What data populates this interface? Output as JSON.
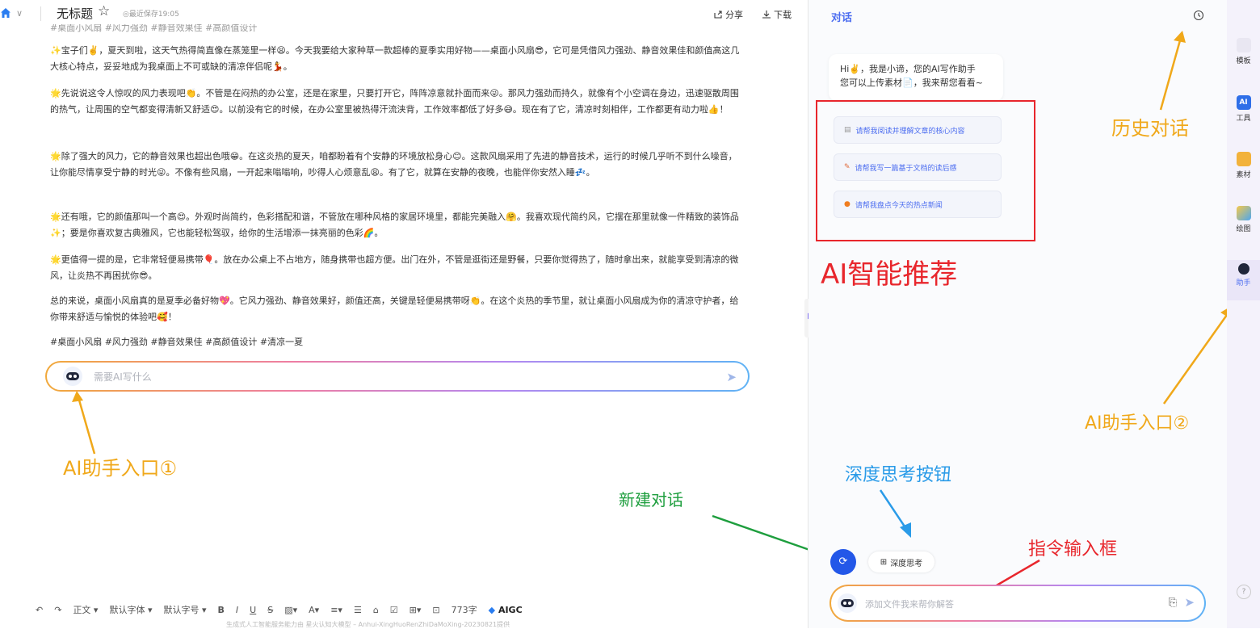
{
  "header": {
    "title": "无标题",
    "saved": "◎最近保存19:05",
    "share": "分享",
    "download": "下载"
  },
  "editor": {
    "clipped_line": "#桌面小风扇 #风力强劲 #静音效果佳 #高颜值设计",
    "paragraphs": [
      "✨宝子们✌️，夏天到啦，这天气热得简直像在蒸笼里一样😫。今天我要给大家种草一款超棒的夏季实用好物——桌面小风扇😎，它可是凭借风力强劲、静音效果佳和颜值高这几大核心特点，妥妥地成为我桌面上不可或缺的清凉伴侣呢💃。",
      "🌟先说说这令人惊叹的风力表现吧👏。不管是在闷热的办公室，还是在家里，只要打开它，阵阵凉意就扑面而来😜。那风力强劲而持久，就像有个小空调在身边，迅速驱散周围的热气，让周围的空气都变得清新又舒适😍。以前没有它的时候，在办公室里被热得汗流浃背，工作效率都低了好多😅。现在有了它，清凉时刻相伴，工作都更有动力啦👍！",
      "🌟除了强大的风力，它的静音效果也超出色哦😁。在这炎热的夏天，咱都盼着有个安静的环境放松身心😊。这款风扇采用了先进的静音技术，运行的时候几乎听不到什么噪音，让你能尽情享受宁静的时光😜。不像有些风扇，一开起来嗡嗡响，吵得人心烦意乱😩。有了它，就算在安静的夜晚，也能伴你安然入睡💤。",
      "🌟还有哦，它的颜值那叫一个高😍。外观时尚简约，色彩搭配和谐，不管放在哪种风格的家居环境里，都能完美融入🤗。我喜欢现代简约风，它摆在那里就像一件精致的装饰品✨；要是你喜欢复古典雅风，它也能轻松驾驭，给你的生活增添一抹亮丽的色彩🌈。",
      "🌟更值得一提的是，它非常轻便易携带🎈。放在办公桌上不占地方，随身携带也超方便。出门在外，不管是逛街还是野餐，只要你觉得热了，随时拿出来，就能享受到清凉的微风，让炎热不再困扰你😎。",
      "总的来说，桌面小风扇真的是夏季必备好物💖。它风力强劲、静音效果好，颜值还高，关键是轻便易携带呀👏。在这个炎热的季节里，就让桌面小风扇成为你的清凉守护者，给你带来舒适与愉悦的体验吧🥰！",
      "#桌面小风扇 #风力强劲 #静音效果佳 #高颜值设计 #清凉一夏"
    ],
    "ai_placeholder": "需要AI写什么",
    "toolbar": {
      "body_style": "正文 ▾",
      "font": "默认字体 ▾",
      "font_size": "默认字号 ▾",
      "bold": "B",
      "italic": "I",
      "underline": "U",
      "strike": "S",
      "word_count": "773字",
      "aigc": "AIGC"
    },
    "footer_note": "生成式人工智能服务能力由 星火认知大模型 – Anhui-XingHuoRenZhiDaMoXing-20230821提供"
  },
  "chat": {
    "title": "对话",
    "greeting_line1": "Hi✌️，我是小谛，您的AI写作助手",
    "greeting_line2": "您可以上传素材📄，我来帮您看看~",
    "suggestions": [
      "请帮我阅读并理解文章的核心内容",
      "请帮我写一篇基于文档的读后感",
      "请帮我盘点今天的热点新闻"
    ],
    "deep_think": "深度思考",
    "input_placeholder": "添加文件我来帮你解答"
  },
  "rail": {
    "items": [
      "模板",
      "工具",
      "素材",
      "绘图",
      "助手"
    ],
    "help": "?"
  },
  "annotations": {
    "history": "历史对话",
    "ai_recommend": "AI智能推荐",
    "entry2": "AI助手入口②",
    "entry1": "AI助手入口①",
    "deep_button": "深度思考按钮",
    "new_chat": "新建对话",
    "command_input": "指令输入框"
  }
}
